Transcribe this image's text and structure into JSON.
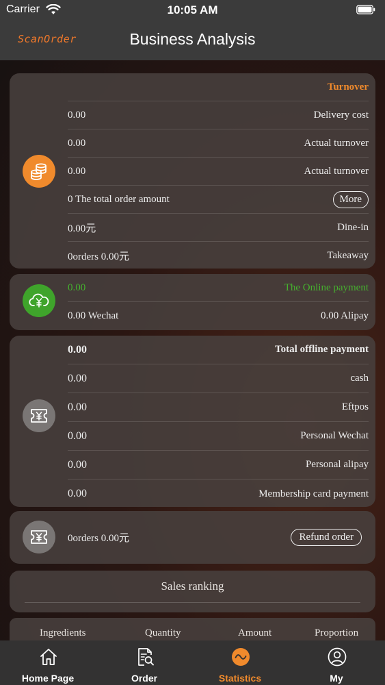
{
  "status": {
    "carrier": "Carrier",
    "time": "10:05 AM"
  },
  "header": {
    "logo": "ScanOrder",
    "title": "Business Analysis"
  },
  "turnover": {
    "title": "Turnover",
    "rows": [
      {
        "value": "0.00",
        "label": "Delivery cost"
      },
      {
        "value": "0.00",
        "label": "Actual turnover"
      },
      {
        "value": "0.00",
        "label": "Actual turnover"
      },
      {
        "value": "0 The total order amount",
        "button": "More"
      },
      {
        "value": "0.00元",
        "label": "Dine-in"
      },
      {
        "value": "0orders  0.00元",
        "label": "Takeaway"
      }
    ]
  },
  "online": {
    "value": "0.00",
    "label": "The Online payment",
    "wechat": "0.00 Wechat",
    "alipay": "0.00 Alipay"
  },
  "offline": {
    "rows": [
      {
        "value": "0.00",
        "label": "Total offline payment"
      },
      {
        "value": "0.00",
        "label": "cash"
      },
      {
        "value": "0.00",
        "label": "Eftpos"
      },
      {
        "value": "0.00",
        "label": "Personal Wechat"
      },
      {
        "value": "0.00",
        "label": "Personal alipay"
      },
      {
        "value": "0.00",
        "label": "Membership card payment"
      }
    ]
  },
  "refund": {
    "value": "0orders 0.00元",
    "button": "Refund order"
  },
  "ranking": {
    "title": "Sales ranking"
  },
  "table": {
    "headers": [
      "Ingredients",
      "Quantity",
      "Amount",
      "Proportion"
    ]
  },
  "tabs": [
    {
      "label": "Home Page",
      "icon": "home-icon"
    },
    {
      "label": "Order",
      "icon": "order-search-icon"
    },
    {
      "label": "Statistics",
      "icon": "statistics-icon",
      "active": true
    },
    {
      "label": "My",
      "icon": "profile-icon"
    }
  ],
  "colors": {
    "accent": "#f08a2c",
    "online": "#45b22e",
    "bar": "#3b3b3b"
  }
}
